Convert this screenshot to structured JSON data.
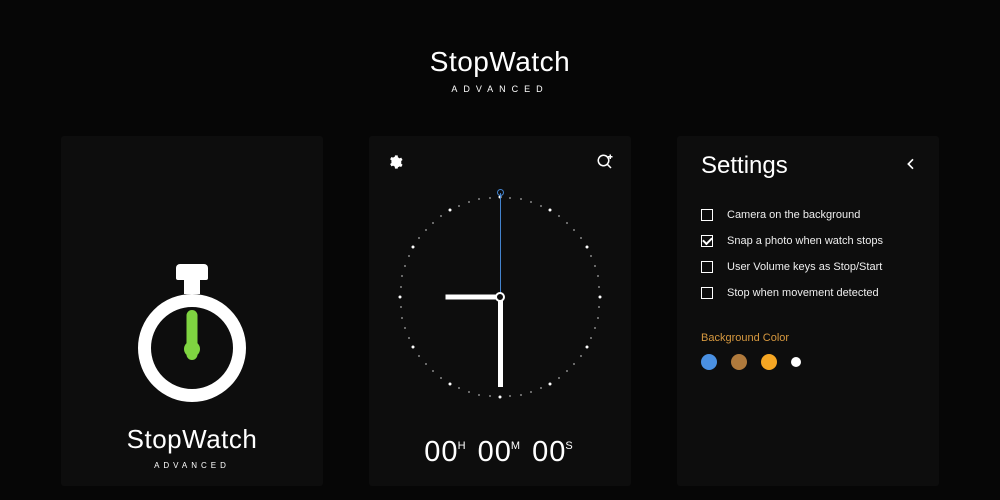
{
  "hero": {
    "title": "StopWatch",
    "subtitle": "ADVANCED"
  },
  "splash": {
    "title": "StopWatch",
    "subtitle": "ADVANCED"
  },
  "timer": {
    "h": "00",
    "h_unit": "H",
    "m": "00",
    "m_unit": "M",
    "s": "00",
    "s_unit": "S"
  },
  "settings": {
    "title": "Settings",
    "options": [
      {
        "label": "Camera on the background",
        "checked": false
      },
      {
        "label": "Snap a photo when watch stops",
        "checked": true
      },
      {
        "label": "User Volume keys as Stop/Start",
        "checked": false
      },
      {
        "label": "Stop when movement detected",
        "checked": false
      }
    ],
    "bg_label": "Background Color",
    "swatches": [
      "#4a90e2",
      "#b07a3c",
      "#f5a623",
      "#ffffff"
    ]
  }
}
